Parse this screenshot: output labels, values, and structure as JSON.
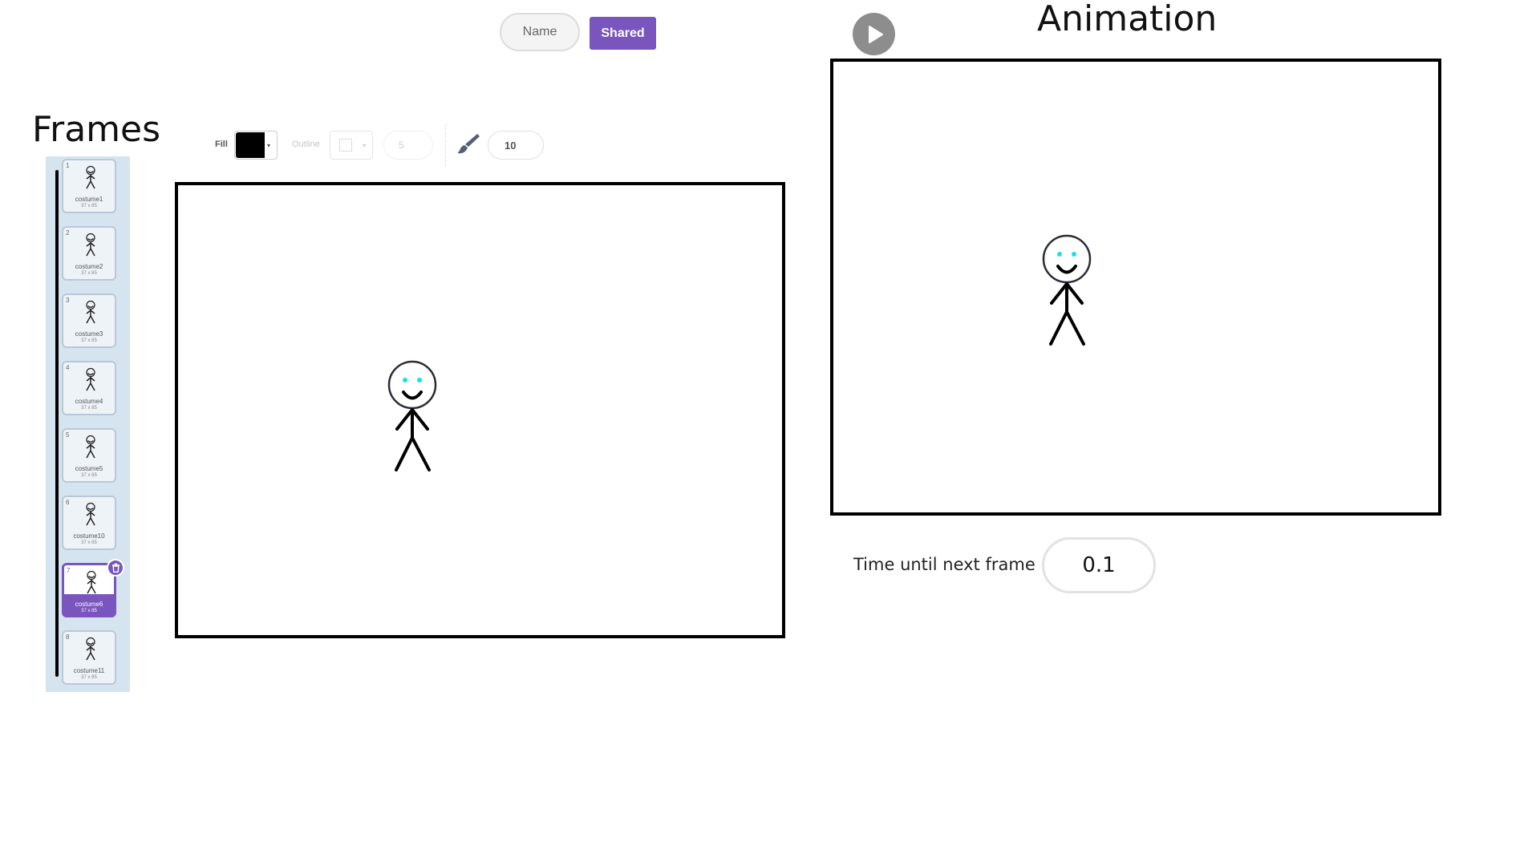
{
  "toggle": {
    "name_label": "Name",
    "shared_label": "Shared"
  },
  "frames_title": "Frames",
  "animation_title": "Animation",
  "frames": [
    {
      "num": "1",
      "name": "costume1",
      "size": "37 x 85"
    },
    {
      "num": "2",
      "name": "costume2",
      "size": "37 x 85"
    },
    {
      "num": "3",
      "name": "costume3",
      "size": "37 x 85"
    },
    {
      "num": "4",
      "name": "costume4",
      "size": "37 x 85"
    },
    {
      "num": "5",
      "name": "costume5",
      "size": "37 x 85"
    },
    {
      "num": "6",
      "name": "costume10",
      "size": "37 x 85"
    },
    {
      "num": "7",
      "name": "costume6",
      "size": "37 x 85"
    },
    {
      "num": "8",
      "name": "costume11",
      "size": "37 x 85"
    }
  ],
  "selected_frame": "7",
  "toolbar": {
    "fill_label": "Fill",
    "fill_color": "#000000",
    "outline_label": "Outline",
    "outline_width": "5",
    "brush_icon": "brush-icon",
    "brush_size": "10"
  },
  "time_label": "Time until next frame",
  "time_value": "0.1",
  "colors": {
    "accent": "#7a55bd",
    "panel": "#d6e4f0",
    "eye": "#18e0e8"
  }
}
